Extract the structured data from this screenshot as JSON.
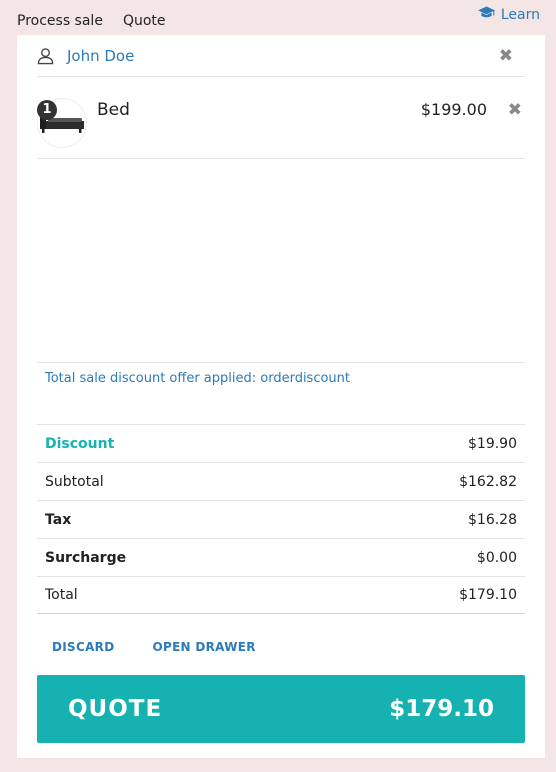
{
  "tabs": [
    {
      "label": "Process sale"
    },
    {
      "label": "Quote"
    }
  ],
  "learn": {
    "label": "Learn",
    "icon": "graduation-cap-icon"
  },
  "customer": {
    "name": "John Doe",
    "icon": "person-icon"
  },
  "cart": {
    "items": [
      {
        "quantity": "1",
        "name": "Bed",
        "price": "$199.00"
      }
    ]
  },
  "discount_message": "Total sale discount offer applied: orderdiscount",
  "totals": {
    "discount": {
      "label": "Discount",
      "value": "$19.90"
    },
    "subtotal": {
      "label": "Subtotal",
      "value": "$162.82"
    },
    "tax": {
      "label": "Tax",
      "value": "$16.28"
    },
    "surcharge": {
      "label": "Surcharge",
      "value": "$0.00"
    },
    "total": {
      "label": "Total",
      "value": "$179.10"
    }
  },
  "actions": {
    "discard": "DISCARD",
    "open_drawer": "OPEN DRAWER"
  },
  "quote_button": {
    "label": "QUOTE",
    "amount": "$179.10"
  },
  "colors": {
    "accent": "#16b2b2",
    "link": "#2d7ab8",
    "background": "#f5e6e6"
  }
}
